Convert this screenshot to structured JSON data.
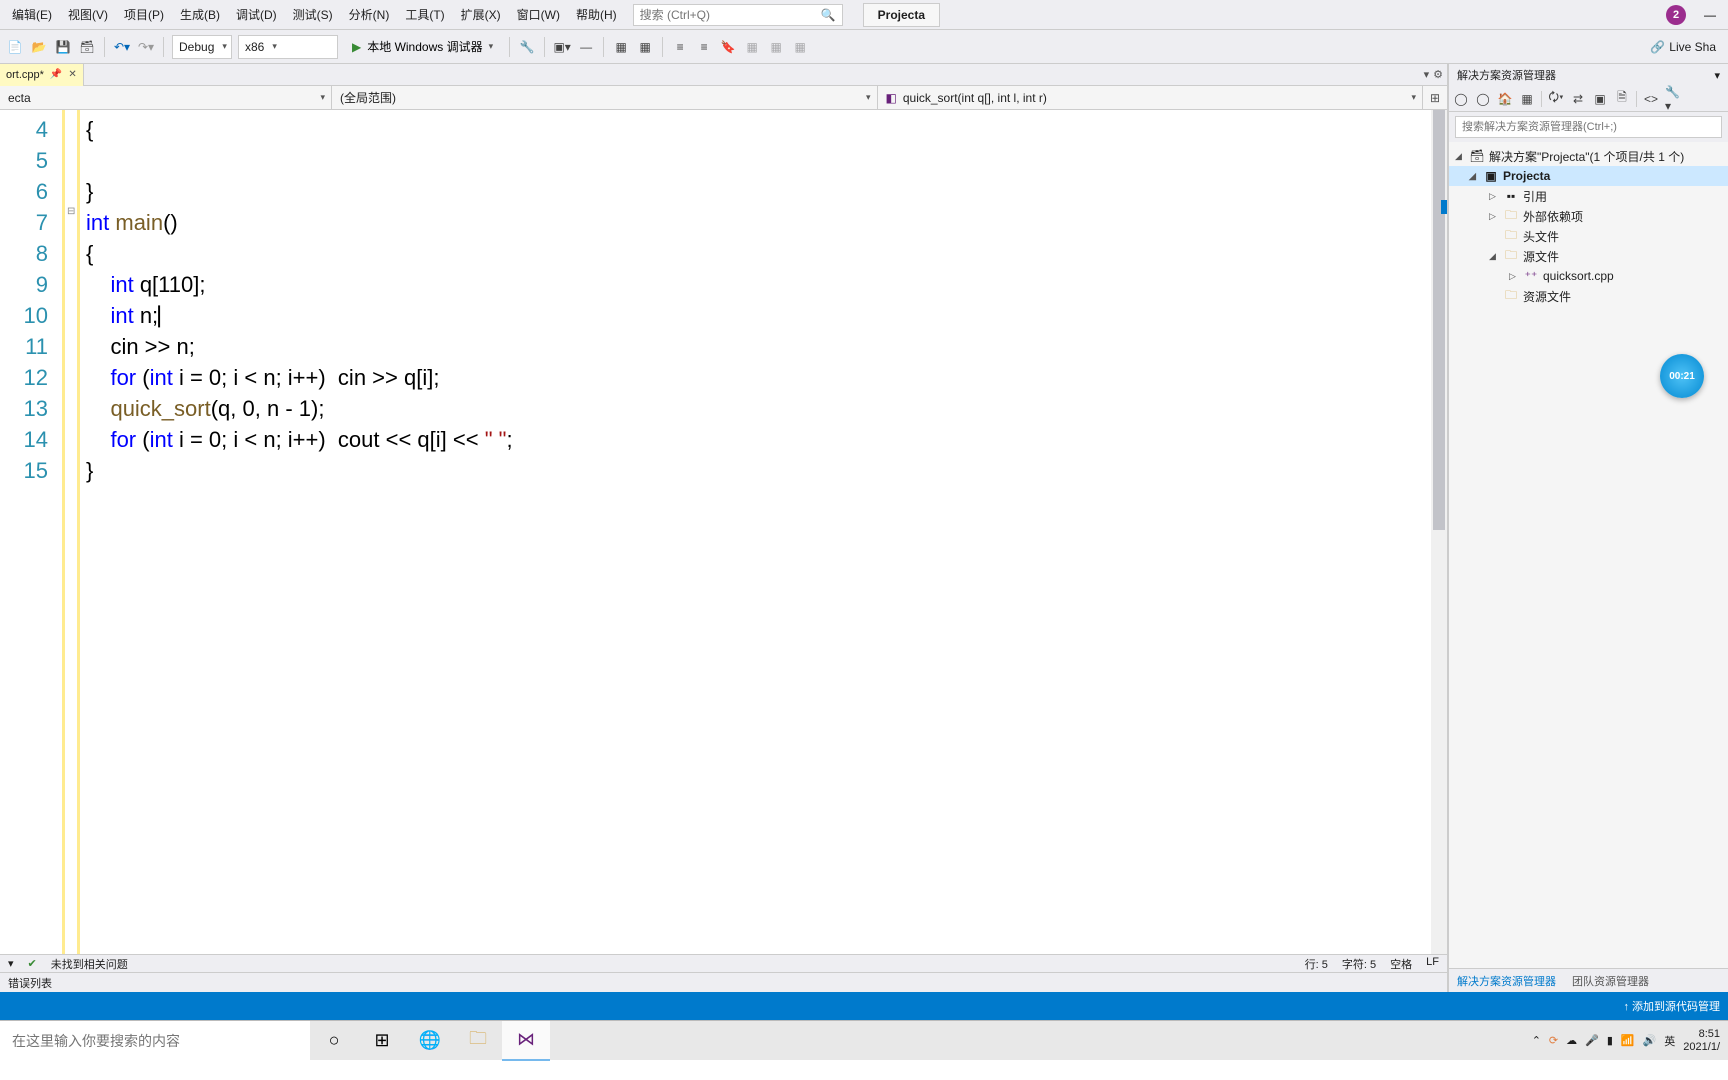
{
  "menu": {
    "items": [
      "编辑(E)",
      "视图(V)",
      "项目(P)",
      "生成(B)",
      "调试(D)",
      "测试(S)",
      "分析(N)",
      "工具(T)",
      "扩展(X)",
      "窗口(W)",
      "帮助(H)"
    ],
    "search_placeholder": "搜索 (Ctrl+Q)",
    "project_label": "Projecta",
    "avatar_initial": "2",
    "minimize": "—"
  },
  "toolbar": {
    "config": "Debug",
    "platform": "x86",
    "debugger_label": "本地 Windows 调试器",
    "live_share": "Live Sha"
  },
  "tab": {
    "name": "ort.cpp*",
    "close": "✕"
  },
  "navbar": {
    "scope1": "ecta",
    "scope2": "(全局范围)",
    "scope3": "quick_sort(int q[], int l, int r)"
  },
  "code": {
    "lines": [
      {
        "n": "4",
        "html": "{"
      },
      {
        "n": "5",
        "html": ""
      },
      {
        "n": "6",
        "html": "}"
      },
      {
        "n": "7",
        "html": "<span class='kw'>int</span> <span class='fn'>main</span>()"
      },
      {
        "n": "8",
        "html": "{"
      },
      {
        "n": "9",
        "html": "    <span class='kw'>int</span> q[110];"
      },
      {
        "n": "10",
        "html": "    <span class='kw'>int</span> n;<span style='font-family:Consolas'>&#x23B8;</span>"
      },
      {
        "n": "11",
        "html": "    cin &gt;&gt; n;"
      },
      {
        "n": "12",
        "html": "    <span class='kw'>for</span> (<span class='kw'>int</span> i = 0; i &lt; n; i++)  cin &gt;&gt; q[i];"
      },
      {
        "n": "13",
        "html": "    <span class='fn'>quick_sort</span>(q, 0, n - 1);"
      },
      {
        "n": "14",
        "html": "    <span class='kw'>for</span> (<span class='kw'>int</span> i = 0; i &lt; n; i++)  cout &lt;&lt; q[i] &lt;&lt; <span class='str'>\" \"</span>;"
      },
      {
        "n": "15",
        "html": "}"
      }
    ]
  },
  "status": {
    "no_issues": "未找到相关问题",
    "line": "行: 5",
    "col": "字符: 5",
    "spaces": "空格",
    "eol": "LF",
    "error_list": "错误列表"
  },
  "sidebar": {
    "title": "解决方案资源管理器",
    "search_placeholder": "搜索解决方案资源管理器(Ctrl+;)",
    "solution": "解决方案\"Projecta\"(1 个项目/共 1 个)",
    "project": "Projecta",
    "refs": "引用",
    "ext_deps": "外部依赖项",
    "headers": "头文件",
    "sources": "源文件",
    "file1": "quicksort.cpp",
    "resources": "资源文件",
    "tab1": "解决方案资源管理器",
    "tab2": "团队资源管理器"
  },
  "timer": "00:21",
  "bluebar": {
    "add_source": "↑ 添加到源代码管理"
  },
  "taskbar": {
    "search_placeholder": "在这里输入你要搜索的内容",
    "ime": "英",
    "time": "8:51",
    "date": "2021/1/"
  }
}
